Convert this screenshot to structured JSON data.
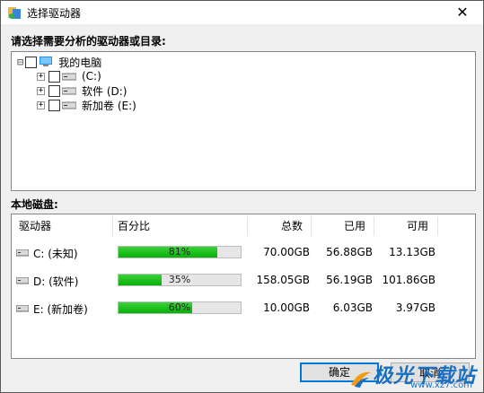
{
  "window": {
    "title": "选择驱动器",
    "close_glyph": "✕"
  },
  "tree_section": {
    "label": "请选择需要分析的驱动器或目录:",
    "root": {
      "label": "我的电脑",
      "expander": "⊟"
    },
    "drives": [
      {
        "label": " (C:)",
        "expander": "+"
      },
      {
        "label": "软件 (D:)",
        "expander": "+"
      },
      {
        "label": "新加卷 (E:)",
        "expander": "+"
      }
    ]
  },
  "disk_section": {
    "label": "本地磁盘:",
    "columns": [
      "驱动器",
      "百分比",
      "总数",
      "已用",
      "可用"
    ],
    "rows": [
      {
        "name": "C: (未知)",
        "percent_label": "81%",
        "percent": 0.81,
        "total": "70.00GB",
        "used": "56.88GB",
        "free": "13.13GB"
      },
      {
        "name": "D: (软件)",
        "percent_label": "35%",
        "percent": 0.35,
        "total": "158.05GB",
        "used": "56.19GB",
        "free": "101.86GB"
      },
      {
        "name": "E: (新加卷)",
        "percent_label": "60%",
        "percent": 0.6,
        "total": "10.00GB",
        "used": "6.03GB",
        "free": "3.97GB"
      }
    ]
  },
  "buttons": {
    "ok": "确定",
    "cancel": "取消"
  },
  "watermark": {
    "text": "极光下载站",
    "sub": "www.xz7.com"
  },
  "colors": {
    "progress_green": "#06b006",
    "default_button_border": "#0078d7"
  }
}
